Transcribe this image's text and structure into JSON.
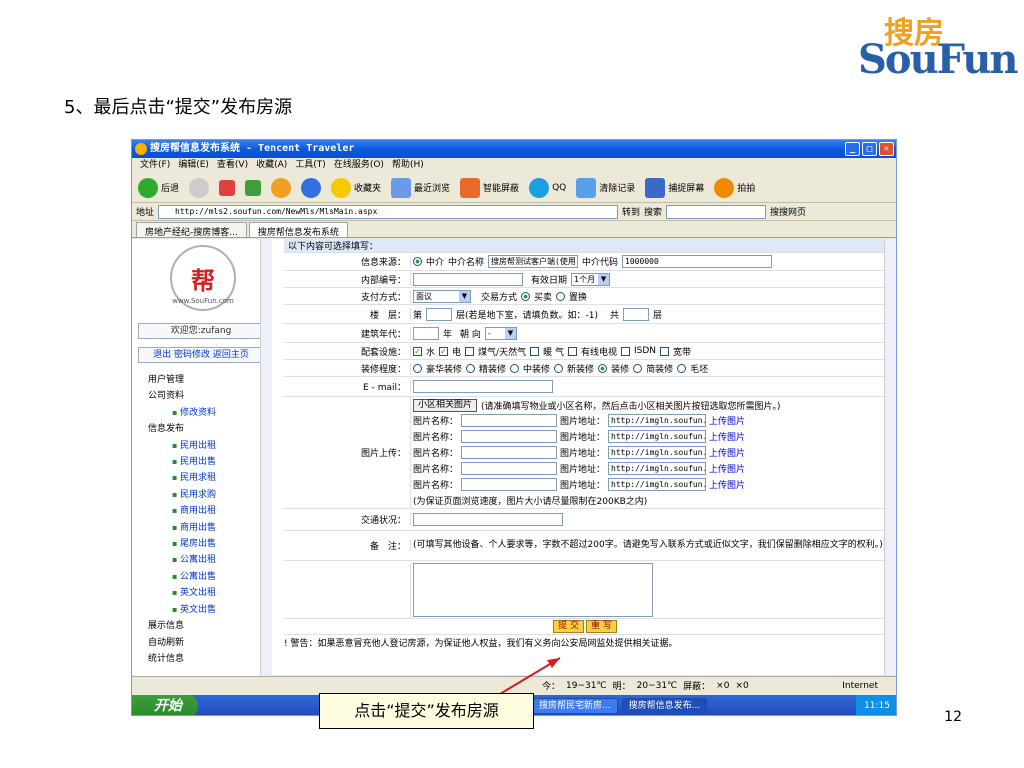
{
  "heading": "5、最后点击“提交”发布房源",
  "logo": {
    "cn": "搜房",
    "en": "SouFun"
  },
  "page_number": "12",
  "callout": "点击“提交”发布房源",
  "window": {
    "title": "搜房帮信息发布系统 - Tencent Traveler",
    "menu": [
      "文件(F)",
      "编辑(E)",
      "查看(V)",
      "收藏(A)",
      "工具(T)",
      "在线服务(O)",
      "帮助(H)"
    ],
    "toolbar": [
      "后退",
      "收藏夹",
      "最近浏览",
      "智能屏蔽",
      "QQ",
      "清除记录",
      "捕捉屏幕",
      "拍拍"
    ],
    "address_label": "地址",
    "address": "http://mls2.soufun.com/NewMls/MlsMain.aspx",
    "goto": "转到",
    "search_label": "搜索",
    "search_web": "搜搜网页",
    "tabs": [
      "房地产经纪-搜房博客...",
      "搜房帮信息发布系统"
    ]
  },
  "sidebar": {
    "badge": "帮",
    "badge_sub": "www.SouFun.com",
    "welcome": "欢迎您:zufang",
    "links": "退出 密码修改 返回主页",
    "tree": [
      {
        "label": "用户管理",
        "sub": false
      },
      {
        "label": "公司资料",
        "sub": false
      },
      {
        "label": "修改资料",
        "sub": true
      },
      {
        "label": "信息发布",
        "sub": false
      },
      {
        "label": "民用出租",
        "sub": true
      },
      {
        "label": "民用出售",
        "sub": true
      },
      {
        "label": "民用求租",
        "sub": true
      },
      {
        "label": "民用求购",
        "sub": true
      },
      {
        "label": "商用出租",
        "sub": true
      },
      {
        "label": "商用出售",
        "sub": true
      },
      {
        "label": "尾房出售",
        "sub": true
      },
      {
        "label": "公寓出租",
        "sub": true
      },
      {
        "label": "公寓出售",
        "sub": true
      },
      {
        "label": "英文出租",
        "sub": true
      },
      {
        "label": "英文出售",
        "sub": true
      },
      {
        "label": "展示信息",
        "sub": false
      },
      {
        "label": "自动刷新",
        "sub": false
      },
      {
        "label": "统计信息",
        "sub": false
      }
    ]
  },
  "form": {
    "header": "以下内容可选择填写：",
    "source_label": "信息来源：",
    "source_option": "中介",
    "agent_name_label": "中介名称",
    "agent_name": "搜房帮测试客户端(使用",
    "agent_code_label": "中介代码",
    "agent_code": "1000000",
    "internal_no_label": "内部编号：",
    "valid_label": "有效日期",
    "valid_value": "1个月",
    "pay_label": "支付方式：",
    "pay_value": "面议",
    "trade_label": "交易方式",
    "trade_opt1": "买卖",
    "trade_opt2": "置换",
    "floor_label": "楼　层：",
    "floor_text1": "第",
    "floor_text2": "层(若是地下室，请填负数。如：-1)",
    "floor_text3": "共",
    "floor_text4": "层",
    "year_label": "建筑年代：",
    "year_text": "年",
    "facing_label": "朝 向",
    "facing_value": "-",
    "facilities_label": "配套设施：",
    "facilities": [
      {
        "label": "水",
        "checked": true
      },
      {
        "label": "电",
        "checked": true
      },
      {
        "label": "煤气/天然气",
        "checked": false
      },
      {
        "label": "暖 气",
        "checked": false
      },
      {
        "label": "有线电视",
        "checked": false
      },
      {
        "label": "ISDN",
        "checked": false
      },
      {
        "label": "宽带",
        "checked": false
      }
    ],
    "decor_label": "装修程度：",
    "decor": [
      {
        "label": "豪华装修",
        "on": false
      },
      {
        "label": "精装修",
        "on": false
      },
      {
        "label": "中装修",
        "on": false
      },
      {
        "label": "新装修",
        "on": false
      },
      {
        "label": "装修",
        "on": true
      },
      {
        "label": "简装修",
        "on": false
      },
      {
        "label": "毛坯",
        "on": false
      }
    ],
    "email_label": "E - mail：",
    "photo_label": "图片上传：",
    "photo_btn": "小区相关图片",
    "photo_hint": "(请准确填写物业或小区名称，然后点击小区相关图片按钮选取您所需图片。)",
    "photo_rows": [
      {
        "name": "图片名称：",
        "addr": "图片地址：",
        "url": "http://imgln.soufun.c",
        "upload": "上传图片"
      },
      {
        "name": "图片名称：",
        "addr": "图片地址：",
        "url": "http://imgln.soufun.c",
        "upload": "上传图片"
      },
      {
        "name": "图片名称：",
        "addr": "图片地址：",
        "url": "http://imgln.soufun.c",
        "upload": "上传图片"
      },
      {
        "name": "图片名称：",
        "addr": "图片地址：",
        "url": "http://imgln.soufun.c",
        "upload": "上传图片"
      },
      {
        "name": "图片名称：",
        "addr": "图片地址：",
        "url": "http://imgln.soufun.c",
        "upload": "上传图片"
      }
    ],
    "photo_note": "(为保证页面浏览速度，图片大小请尽量限制在200KB之内)",
    "traffic_label": "交通状况：",
    "remark_label": "备　注：",
    "remark_hint": "(可填写其他设备、个人要求等，字数不超过200字。请避免写入联系方式或近似文字，我们保留删除相应文字的权利。)",
    "submit": "提 交",
    "reset": "重 写",
    "warning": "! 警告：如果恶意冒充他人登记房源，为保证他人权益，我们有义务向公安局网监处提供相关证据。"
  },
  "status": {
    "today": "今：",
    "today_temp": "19~31℃",
    "tomorrow": "明：",
    "tomorrow_temp": "20~31℃",
    "block": "屏蔽：",
    "count1": "×0",
    "count2": "×0",
    "zone": "Internet"
  },
  "taskbar": {
    "start": "开始",
    "items": [
      "搜房帮民宅新房...",
      "搜房帮信息发布..."
    ],
    "clock": "11:15"
  }
}
